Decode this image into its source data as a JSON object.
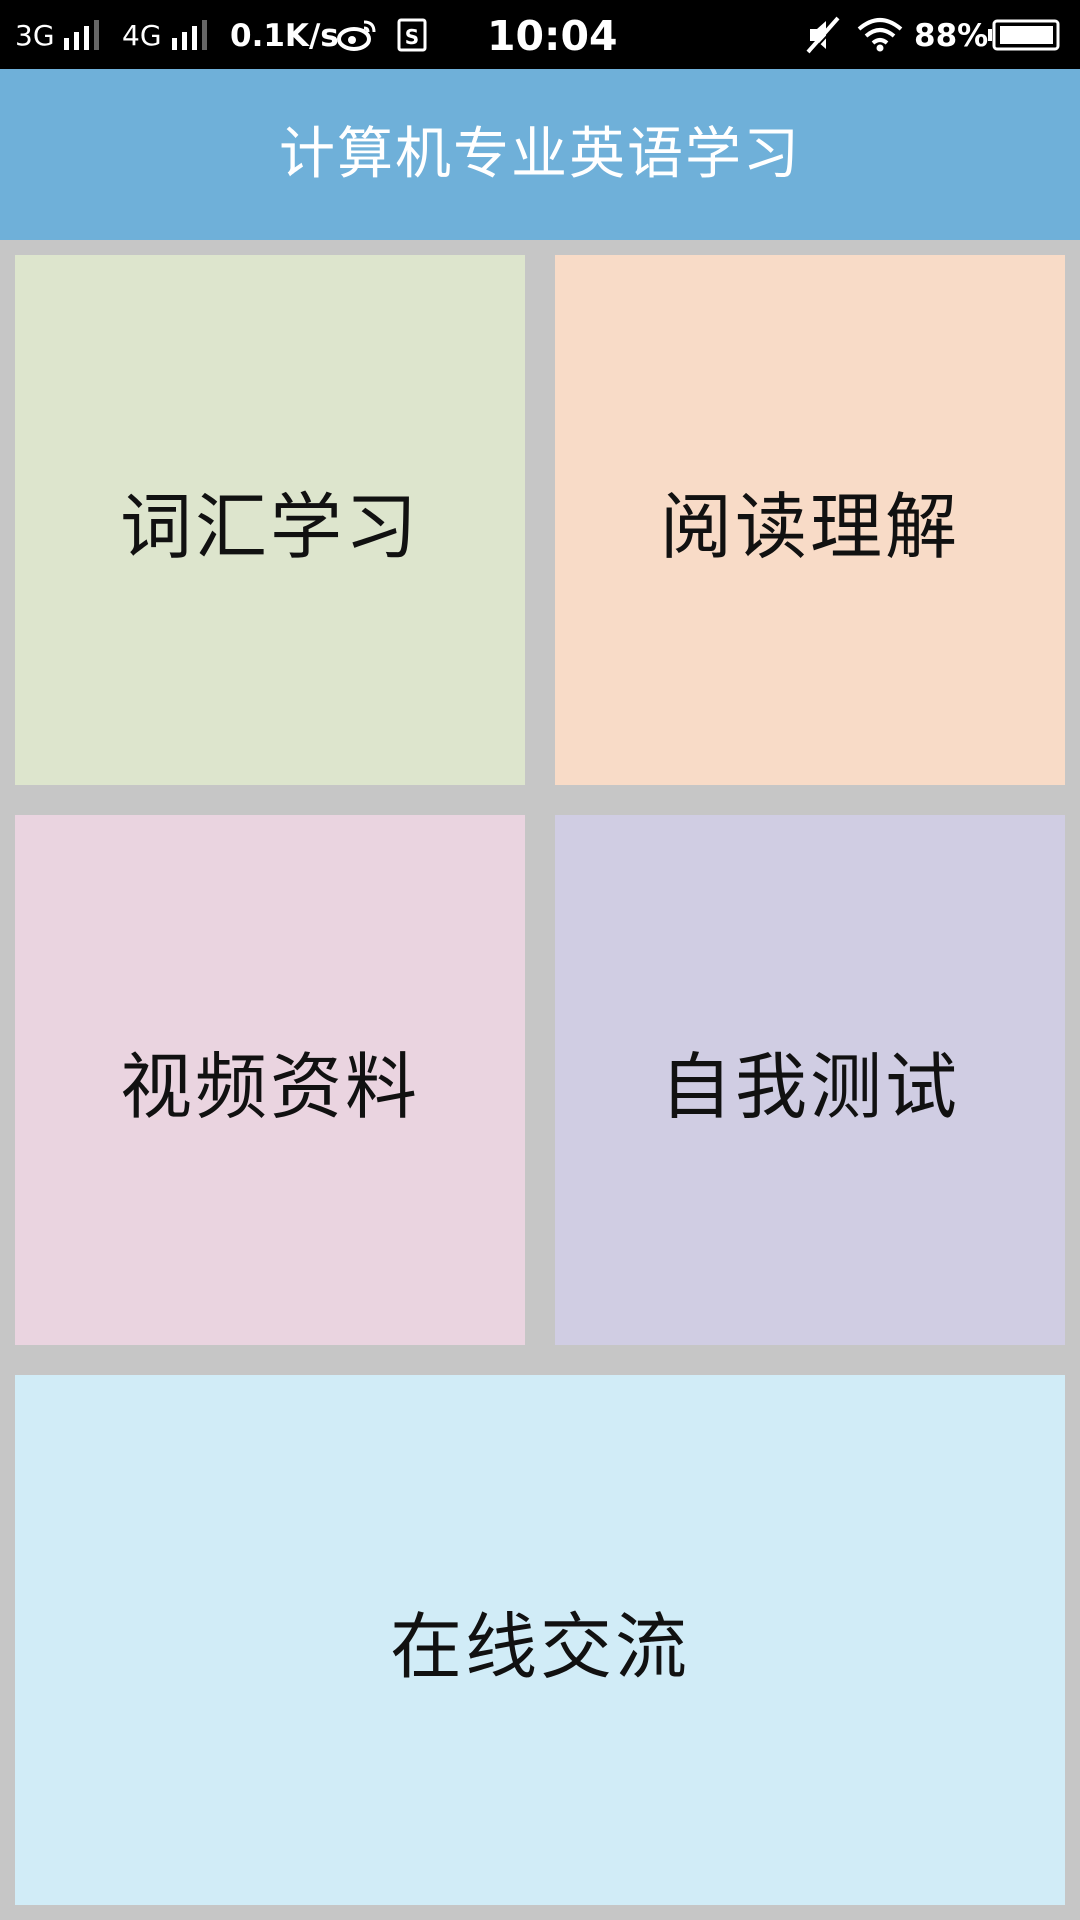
{
  "status_bar": {
    "network1": "3G",
    "network2": "4G",
    "speed": "0.1K/s",
    "time": "10:04",
    "battery": "88%",
    "icons": [
      "signal-icon",
      "signal-icon",
      "weibo-icon",
      "sim-s-icon",
      "mute-icon",
      "wifi-icon",
      "battery-icon"
    ]
  },
  "header": {
    "title": "计算机专业英语学习"
  },
  "tiles": [
    {
      "label": "词汇学习",
      "color": "#dde5cd"
    },
    {
      "label": "阅读理解",
      "color": "#f8dbc7"
    },
    {
      "label": "视频资料",
      "color": "#ead4e0"
    },
    {
      "label": "自我测试",
      "color": "#d0cde3"
    },
    {
      "label": "在线交流",
      "color": "#d1ecf7"
    }
  ],
  "colors": {
    "background": "#c6c6c6",
    "header": "#6fb0d9",
    "status_bar": "#000000"
  }
}
